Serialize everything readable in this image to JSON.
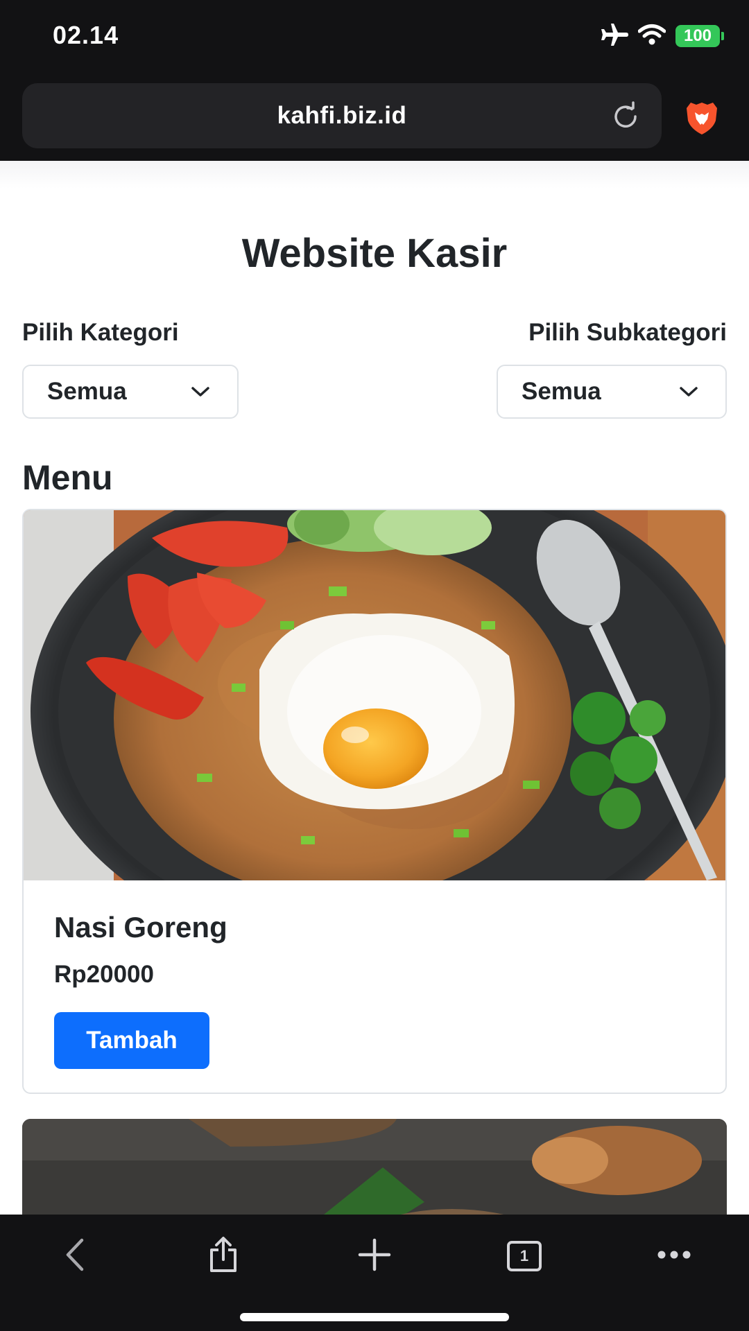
{
  "status_bar": {
    "time": "02.14",
    "battery": "100",
    "icons": [
      "airplane-icon",
      "wifi-icon",
      "battery-icon"
    ]
  },
  "browser": {
    "url": "kahfi.biz.id",
    "icons": [
      "reload-icon",
      "brave-lion-icon"
    ],
    "toolbar_icons": [
      "back-icon",
      "share-icon",
      "new-tab-icon",
      "tabs-icon",
      "more-icon"
    ],
    "tab_count": "1"
  },
  "page": {
    "title": "Website Kasir",
    "category_label": "Pilih Kategori",
    "category_value": "Semua",
    "subcategory_label": "Pilih Subkategori",
    "subcategory_value": "Semua",
    "menu_heading": "Menu",
    "items": [
      {
        "name": "Nasi Goreng",
        "price": "Rp20000",
        "button": "Tambah",
        "image": "nasi-goreng-fried-egg-photo"
      }
    ]
  },
  "colors": {
    "chrome_bg": "#121214",
    "urlbar_bg": "#232326",
    "primary_button": "#0d6efd",
    "battery_green": "#34c759",
    "border": "#dee2e6",
    "text": "#212529"
  }
}
